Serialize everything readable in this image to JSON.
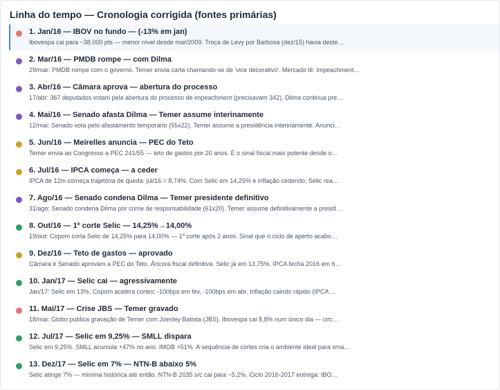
{
  "panel": {
    "title": "Linha do tempo — Cronologia corrigida (fontes primárias)"
  },
  "colors": {
    "red": "#e57373",
    "purple": "#7e57c2",
    "gold": "#c9a227",
    "green": "#2e9e6a",
    "selected_accent": "#3b82f6"
  },
  "items": [
    {
      "title": "1. Jan/16 — IBOV no fundo — (-13% em jan)",
      "desc": "Ibovespa cai para ~38.000 pts — menor nível desde mar/2009. Troca de Levy por Barbosa (dez/15) havia deste…",
      "color": "#e57373"
    },
    {
      "title": "2. Mar/16 — PMDB rompe — com Dilma",
      "desc": "29/mar: PMDB rompe com o governo. Temer envia carta chamando-se de 'vice decorativo'. Mercado lê: impeachment…",
      "color": "#7e57c2"
    },
    {
      "title": "3. Abr/16 — Câmara aprova — abertura do processo",
      "desc": "17/abr: 367 deputados votam pela abertura do processo de impeachment (precisavam 342). Dilma continua pre…",
      "color": "#7e57c2"
    },
    {
      "title": "4. Mai/16 — Senado afasta Dilma — Temer assume interinamente",
      "desc": "12/mai: Senado vota pelo afastamento temporário (55x22). Temer assume a presidência interinamente. Anunci…",
      "color": "#7e57c2"
    },
    {
      "title": "5. Jun/16 — Meirelles anuncia — PEC do Teto",
      "desc": "Temer envia ao Congresso a PEC 241/55 — teto de gastos por 20 anos. É o sinal fiscal mais potente desde o…",
      "color": "#c9a227"
    },
    {
      "title": "6. Jul/16 — IPCA começa — a ceder",
      "desc": "IPCA de 12m começa trajetória de queda: jul/16 = 8,74%. Com Selic em 14,25% e inflação cedendo, Selic rea…",
      "color": "#c9a227"
    },
    {
      "title": "7. Ago/16 — Senado condena Dilma — Temer presidente definitivo",
      "desc": "31/ago: Senado condena Dilma por crime de responsabilidade (61x20). Temer assume definitivamente a presid…",
      "color": "#7e57c2"
    },
    {
      "title": "8. Out/16 — 1º corte Selic — 14,25%→14,00%",
      "desc": "19/out: Copom corta Selic de 14,25% para 14,00% — 1º corte após 2 anos. Sinal que o ciclo de aperto acabo…",
      "color": "#2e9e6a"
    },
    {
      "title": "9. Dez/16 — Teto de gastos — aprovado",
      "desc": "Câmara e Senado aprovam a PEC do Teto. Âncora fiscal definitiva. Selic já em 13,75%. IPCA fecha 2016 em 6…",
      "color": "#c9a227"
    },
    {
      "title": "10. Jan/17 — Selic cai — agressivamente",
      "desc": "Jan/17: Selic em 13%. Copom acelera cortes: -100bps em fev, -100bps em abr. Inflação caindo rápido (IPCA …",
      "color": "#2e9e6a"
    },
    {
      "title": "11. Mai/17 — Crise JBS — Temer gravado",
      "desc": "18/mai: Globo publica gravação de Temer com Joesley Batista (JBS). Ibovespa cai 8,8% num único dia — circ…",
      "color": "#e57373"
    },
    {
      "title": "12. Jul/17 — Selic em 9,25% — SMLL dispara",
      "desc": "Selic em 9,25%. SMLL acumula +47% no ano. IMOB +51%. A sequência de cortes cria o ambiente ideal para sma…",
      "color": "#2e9e6a"
    },
    {
      "title": "13. Dez/17 — Selic em 7% — NTN-B abaixo 5%",
      "desc": "Selic atinge 7% — mínima histórica até então. NTN-B 2035 s/c cai para ~5,2%. Ciclo 2016-2017 entrega: IBO…",
      "color": "#2e9e6a"
    }
  ]
}
